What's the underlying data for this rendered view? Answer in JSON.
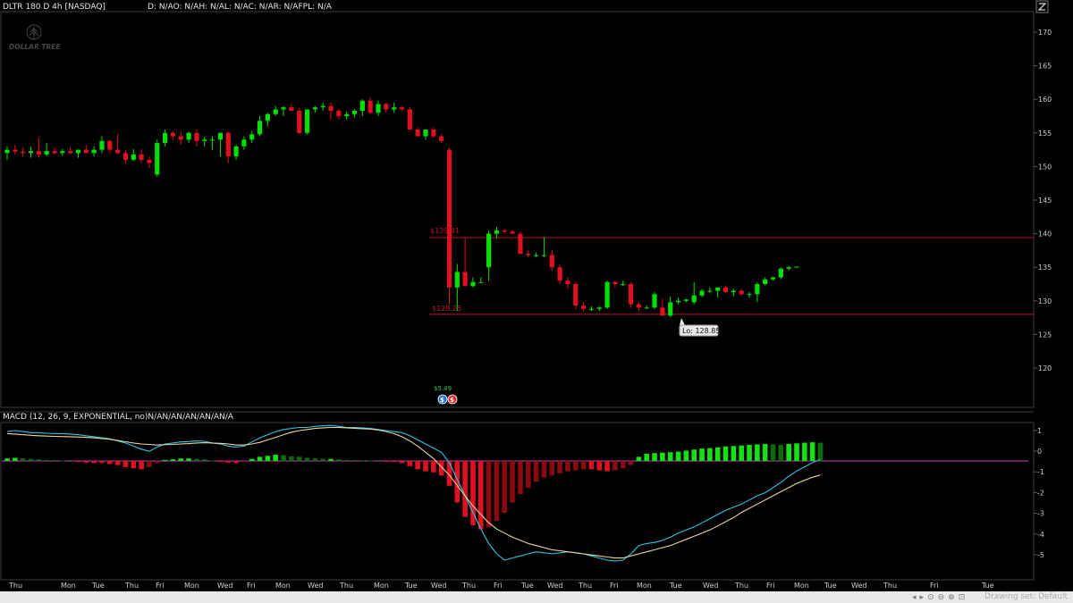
{
  "header": {
    "symbol": "DLTR 180 D 4h [NASDAQ]",
    "quote": "D: N/AO: N/AH: N/AL: N/AC: N/AR: N/AFPL: N/A",
    "logo_text": "DOLLAR TREE",
    "top_right_icon": "expand-icon"
  },
  "macd_header": "MACD (12, 26, 9, EXPONENTIAL, no)N/AN/AN/AN/AN/AN/A",
  "price_axis": {
    "ticks": [
      "170",
      "165",
      "160",
      "155",
      "150",
      "145",
      "140",
      "135",
      "130",
      "125",
      "120"
    ]
  },
  "macd_axis": {
    "ticks": [
      "1",
      "0",
      "-1",
      "-2",
      "-3",
      "-4",
      "-5"
    ]
  },
  "time_axis": {
    "labels": [
      "Thu",
      "Mon",
      "Tue",
      "Thu",
      "Fri",
      "Mon",
      "Wed",
      "Fri",
      "Mon",
      "Wed",
      "Thu",
      "Mon",
      "Tue",
      "Wed",
      "Thu",
      "Fri",
      "Tue",
      "Wed",
      "Thu",
      "Fri",
      "Mon",
      "Tue",
      "Wed",
      "Thu",
      "Fri",
      "Mon",
      "Tue",
      "Wed",
      "Thu",
      "Fri",
      "Tue"
    ]
  },
  "annotations": {
    "level_high": "$139.41",
    "level_low": "$129.25",
    "low_bubble": "Lo: 128.85",
    "earnings_value": "$5.49"
  },
  "bottom_status": "Drawing set: Default",
  "colors": {
    "up": "#00e000",
    "down": "#e01020",
    "macd_line": "#2ec4e6",
    "signal_line": "#e8d6a0",
    "level": "#c0142a"
  },
  "chart_data": [
    {
      "type": "candlestick",
      "title": "DLTR 180 D 4h [NASDAQ]",
      "ylim": [
        115,
        172
      ],
      "candles": [
        [
          152.0,
          153.0,
          151.0,
          152.5
        ],
        [
          152.5,
          153.2,
          151.8,
          152.2
        ],
        [
          152.2,
          152.8,
          151.5,
          152.0
        ],
        [
          152.0,
          153.0,
          151.3,
          152.3
        ],
        [
          152.3,
          154.3,
          151.3,
          151.8
        ],
        [
          151.8,
          153.5,
          151.5,
          152.3
        ],
        [
          152.3,
          152.8,
          151.8,
          152.0
        ],
        [
          152.0,
          152.6,
          151.6,
          152.3
        ],
        [
          152.3,
          152.9,
          151.8,
          152.0
        ],
        [
          152.0,
          152.5,
          151.3,
          152.5
        ],
        [
          152.5,
          153.2,
          152.0,
          152.0
        ],
        [
          152.0,
          153.0,
          151.5,
          152.5
        ],
        [
          152.5,
          154.5,
          152.0,
          153.8
        ],
        [
          153.8,
          154.0,
          152.0,
          152.5
        ],
        [
          152.5,
          154.8,
          151.8,
          152.0
        ],
        [
          152.0,
          152.5,
          150.5,
          151.0
        ],
        [
          151.0,
          152.6,
          150.8,
          151.8
        ],
        [
          151.8,
          152.6,
          150.5,
          151.0
        ],
        [
          151.0,
          151.5,
          149.8,
          150.5
        ],
        [
          148.8,
          154.0,
          148.5,
          153.5
        ],
        [
          153.5,
          155.5,
          153.0,
          155.0
        ],
        [
          155.0,
          155.3,
          154.0,
          154.5
        ],
        [
          154.5,
          155.2,
          153.3,
          154.0
        ],
        [
          154.0,
          155.2,
          153.5,
          155.0
        ],
        [
          155.0,
          155.5,
          153.0,
          153.8
        ],
        [
          153.8,
          154.5,
          153.0,
          154.0
        ],
        [
          154.0,
          154.5,
          152.5,
          154.0
        ],
        [
          154.0,
          155.0,
          151.5,
          155.0
        ],
        [
          155.0,
          155.2,
          150.5,
          151.5
        ],
        [
          151.5,
          153.2,
          151.0,
          153.0
        ],
        [
          153.0,
          154.5,
          152.5,
          154.0
        ],
        [
          154.0,
          155.3,
          153.5,
          154.8
        ],
        [
          154.8,
          157.5,
          154.5,
          156.8
        ],
        [
          156.8,
          158.0,
          156.0,
          157.8
        ],
        [
          157.8,
          159.0,
          157.5,
          158.5
        ],
        [
          158.5,
          159.0,
          157.5,
          158.8
        ],
        [
          158.8,
          159.3,
          158.3,
          158.3
        ],
        [
          158.3,
          158.7,
          154.8,
          155.0
        ],
        [
          155.0,
          158.5,
          154.8,
          158.5
        ],
        [
          158.5,
          159.0,
          158.0,
          158.8
        ],
        [
          158.8,
          159.5,
          158.3,
          159.0
        ],
        [
          159.0,
          159.5,
          157.0,
          158.3
        ],
        [
          158.3,
          158.6,
          157.0,
          157.5
        ],
        [
          157.5,
          158.2,
          157.0,
          157.8
        ],
        [
          157.8,
          158.5,
          157.3,
          158.3
        ],
        [
          158.3,
          160.0,
          157.5,
          159.8
        ],
        [
          159.8,
          160.2,
          157.8,
          158.0
        ],
        [
          158.0,
          159.8,
          157.5,
          159.3
        ],
        [
          159.3,
          159.5,
          158.0,
          158.5
        ],
        [
          158.5,
          159.5,
          158.0,
          158.8
        ],
        [
          158.8,
          159.0,
          158.2,
          158.5
        ],
        [
          158.5,
          158.8,
          155.5,
          155.5
        ],
        [
          155.5,
          155.8,
          154.5,
          154.5
        ],
        [
          154.5,
          155.5,
          154.0,
          155.5
        ],
        [
          155.5,
          155.8,
          154.3,
          154.5
        ],
        [
          154.5,
          154.8,
          153.5,
          153.8
        ],
        [
          152.5,
          152.8,
          129.5,
          132.0
        ],
        [
          132.0,
          135.5,
          128.5,
          134.3
        ],
        [
          134.3,
          139.5,
          132.2,
          132.2
        ],
        [
          132.2,
          133.5,
          132.0,
          132.8
        ],
        [
          132.8,
          133.5,
          132.8,
          132.8
        ],
        [
          135.0,
          140.5,
          133.0,
          140.0
        ],
        [
          140.0,
          141.0,
          139.3,
          140.5
        ],
        [
          140.5,
          140.8,
          140.1,
          140.3
        ],
        [
          140.3,
          140.6,
          140.0,
          140.0
        ],
        [
          140.0,
          140.3,
          137.0,
          137.0
        ],
        [
          137.0,
          137.5,
          136.5,
          136.8
        ],
        [
          136.8,
          137.2,
          136.5,
          136.8
        ],
        [
          136.8,
          139.5,
          136.5,
          136.8
        ],
        [
          136.8,
          137.5,
          134.5,
          135.0
        ],
        [
          135.0,
          135.5,
          132.5,
          133.0
        ],
        [
          133.0,
          133.5,
          131.8,
          132.5
        ],
        [
          132.5,
          132.8,
          128.8,
          129.3
        ],
        [
          129.3,
          129.8,
          128.5,
          128.8
        ],
        [
          128.8,
          129.2,
          128.5,
          128.8
        ],
        [
          128.8,
          129.2,
          128.5,
          129.0
        ],
        [
          129.0,
          133.0,
          128.8,
          132.8
        ],
        [
          132.8,
          133.0,
          132.0,
          132.5
        ],
        [
          132.5,
          133.0,
          132.2,
          132.5
        ],
        [
          132.5,
          132.8,
          129.0,
          129.5
        ],
        [
          129.5,
          129.8,
          128.5,
          129.0
        ],
        [
          129.0,
          129.3,
          128.8,
          129.0
        ],
        [
          129.0,
          131.3,
          128.8,
          131.0
        ],
        [
          129.0,
          130.3,
          127.8,
          127.8
        ],
        [
          127.8,
          130.6,
          127.6,
          129.8
        ],
        [
          129.8,
          130.5,
          129.5,
          130.0
        ],
        [
          130.0,
          130.3,
          129.8,
          130.2
        ],
        [
          129.8,
          132.8,
          129.5,
          130.8
        ],
        [
          130.8,
          131.8,
          130.5,
          131.5
        ],
        [
          131.5,
          132.0,
          131.2,
          131.5
        ],
        [
          131.5,
          132.0,
          130.5,
          132.0
        ],
        [
          132.0,
          132.3,
          131.2,
          131.3
        ],
        [
          131.3,
          131.8,
          130.7,
          131.5
        ],
        [
          131.5,
          131.8,
          130.8,
          131.0
        ],
        [
          131.0,
          131.3,
          130.5,
          131.0
        ],
        [
          131.0,
          132.8,
          129.8,
          132.5
        ],
        [
          132.5,
          133.5,
          132.3,
          133.2
        ],
        [
          133.2,
          133.6,
          133.0,
          133.5
        ],
        [
          133.5,
          135.0,
          133.2,
          134.8
        ],
        [
          134.8,
          135.2,
          134.5,
          135.0
        ],
        [
          135.0,
          135.1,
          134.9,
          135.1
        ]
      ],
      "levels": [
        139.41,
        128.0
      ],
      "yaxis_ticks": [
        170,
        165,
        160,
        155,
        150,
        145,
        140,
        135,
        130,
        125,
        120
      ]
    },
    {
      "type": "macd",
      "title": "MACD (12, 26, 9, EXPONENTIAL, no)",
      "ylim": [
        -5.7,
        1.6
      ],
      "macd": [
        0.9,
        0.95,
        0.9,
        0.85,
        0.85,
        0.82,
        0.8,
        0.8,
        0.78,
        0.75,
        0.7,
        0.65,
        0.6,
        0.55,
        0.45,
        0.35,
        0.2,
        0.05,
        -0.05,
        0.15,
        0.3,
        0.35,
        0.4,
        0.42,
        0.45,
        0.43,
        0.35,
        0.3,
        0.2,
        0.15,
        0.2,
        0.4,
        0.6,
        0.75,
        0.9,
        1.0,
        1.05,
        1.1,
        1.1,
        1.15,
        1.18,
        1.2,
        1.15,
        1.1,
        1.1,
        1.08,
        1.05,
        1.0,
        0.95,
        0.9,
        0.85,
        0.7,
        0.5,
        0.3,
        0.1,
        -0.1,
        -0.6,
        -1.4,
        -2.2,
        -3.0,
        -3.8,
        -4.5,
        -5.0,
        -5.3,
        -5.2,
        -5.1,
        -5.0,
        -4.9,
        -4.95,
        -5.0,
        -4.95,
        -4.9,
        -4.95,
        -5.0,
        -5.1,
        -5.2,
        -5.3,
        -5.35,
        -5.3,
        -5.0,
        -4.6,
        -4.5,
        -4.45,
        -4.35,
        -4.2,
        -4.0,
        -3.85,
        -3.7,
        -3.5,
        -3.3,
        -3.1,
        -2.9,
        -2.75,
        -2.6,
        -2.4,
        -2.2,
        -2.05,
        -1.8,
        -1.55,
        -1.25,
        -1.0,
        -0.8,
        -0.6,
        -0.45
      ],
      "signal": [
        0.8,
        0.78,
        0.75,
        0.72,
        0.7,
        0.68,
        0.67,
        0.66,
        0.65,
        0.64,
        0.62,
        0.6,
        0.56,
        0.53,
        0.47,
        0.41,
        0.35,
        0.3,
        0.28,
        0.25,
        0.27,
        0.28,
        0.3,
        0.32,
        0.35,
        0.36,
        0.35,
        0.33,
        0.3,
        0.25,
        0.25,
        0.3,
        0.38,
        0.5,
        0.62,
        0.75,
        0.87,
        0.95,
        1.0,
        1.05,
        1.08,
        1.1,
        1.1,
        1.08,
        1.06,
        1.04,
        1.02,
        0.98,
        0.9,
        0.8,
        0.65,
        0.45,
        0.2,
        -0.1,
        -0.4,
        -0.8,
        -1.2,
        -1.7,
        -2.2,
        -2.7,
        -3.1,
        -3.5,
        -3.8,
        -4.0,
        -4.2,
        -4.35,
        -4.5,
        -4.6,
        -4.7,
        -4.8,
        -4.85,
        -4.9,
        -4.95,
        -5.0,
        -5.05,
        -5.1,
        -5.15,
        -5.2,
        -5.2,
        -5.1,
        -5.0,
        -4.9,
        -4.8,
        -4.7,
        -4.6,
        -4.45,
        -4.3,
        -4.15,
        -4.0,
        -3.85,
        -3.65,
        -3.45,
        -3.25,
        -3.0,
        -2.8,
        -2.6,
        -2.4,
        -2.2,
        -2.0,
        -1.8,
        -1.6,
        -1.45,
        -1.3,
        -1.2
      ],
      "histogram": [
        0.12,
        0.15,
        0.12,
        0.1,
        0.08,
        0.05,
        0.04,
        0.02,
        0.0,
        -0.05,
        -0.08,
        -0.1,
        -0.1,
        -0.15,
        -0.2,
        -0.3,
        -0.35,
        -0.4,
        -0.3,
        -0.1,
        0.05,
        0.08,
        0.12,
        0.12,
        0.1,
        0.08,
        0.02,
        -0.02,
        -0.08,
        -0.1,
        -0.05,
        0.1,
        0.2,
        0.25,
        0.3,
        0.28,
        0.22,
        0.2,
        0.15,
        0.12,
        0.1,
        0.1,
        0.08,
        0.05,
        0.04,
        0.03,
        0.02,
        0.0,
        -0.02,
        -0.05,
        -0.1,
        -0.25,
        -0.4,
        -0.5,
        -0.55,
        -0.7,
        -1.2,
        -2.0,
        -2.7,
        -3.1,
        -3.3,
        -3.2,
        -2.9,
        -2.5,
        -2.0,
        -1.6,
        -1.3,
        -1.0,
        -0.8,
        -0.7,
        -0.6,
        -0.5,
        -0.45,
        -0.4,
        -0.4,
        -0.45,
        -0.5,
        -0.45,
        -0.35,
        -0.2,
        0.2,
        0.35,
        0.38,
        0.4,
        0.42,
        0.45,
        0.5,
        0.55,
        0.6,
        0.62,
        0.65,
        0.7,
        0.72,
        0.75,
        0.78,
        0.8,
        0.82,
        0.8,
        0.78,
        0.82,
        0.85,
        0.88,
        0.9,
        0.88
      ],
      "yaxis_ticks": [
        1,
        0,
        -1,
        -2,
        -3,
        -4,
        -5
      ]
    }
  ]
}
